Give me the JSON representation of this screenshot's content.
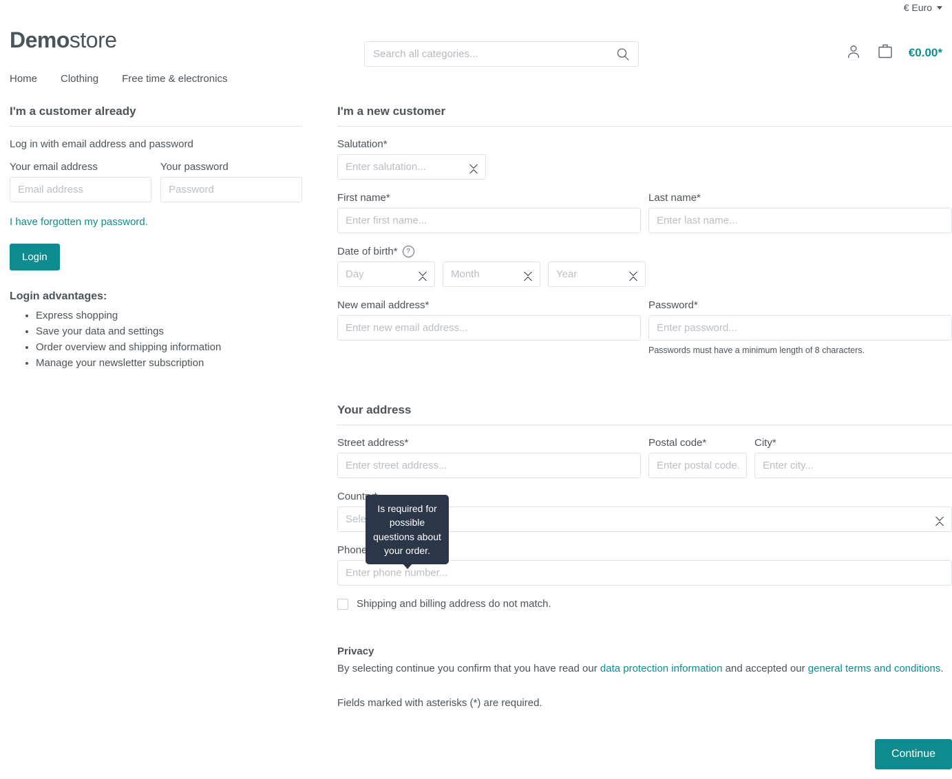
{
  "topbar": {
    "currency": "€ Euro",
    "caret_icon": "chevron-down-icon"
  },
  "header": {
    "logo_bold": "Demo",
    "logo_light": "store",
    "search_placeholder": "Search all categories...",
    "search_value": "",
    "search_icon": "search-icon",
    "account_icon": "user-icon",
    "cart_icon": "shopping-bag-icon",
    "cart_total": "€0.00*"
  },
  "nav": {
    "items": [
      {
        "label": "Home"
      },
      {
        "label": "Clothing"
      },
      {
        "label": "Free time & electronics"
      }
    ]
  },
  "login": {
    "title": "I'm a customer already",
    "subtitle": "Log in with email address and password",
    "email_label": "Your email address",
    "email_placeholder": "Email address",
    "email_value": "",
    "password_label": "Your password",
    "password_placeholder": "Password",
    "password_value": "",
    "forgot_link": "I have forgotten my password.",
    "login_button": "Login",
    "advantages_title": "Login advantages:",
    "advantages": [
      "Express shopping",
      "Save your data and settings",
      "Order overview and shipping information",
      "Manage your newsletter subscription"
    ]
  },
  "register": {
    "title": "I'm a new customer",
    "salutation_label": "Salutation*",
    "salutation_placeholder": "Enter salutation...",
    "firstname_label": "First name*",
    "firstname_placeholder": "Enter first name...",
    "firstname_value": "",
    "lastname_label": "Last name*",
    "lastname_placeholder": "Enter last name...",
    "lastname_value": "",
    "dob_label": "Date of birth*",
    "dob_help_icon": "question-mark-icon",
    "dob_day_placeholder": "Day",
    "dob_month_placeholder": "Month",
    "dob_year_placeholder": "Year",
    "email_label": "New email address*",
    "email_placeholder": "Enter new email address...",
    "email_value": "",
    "password_label": "Password*",
    "password_placeholder": "Enter password...",
    "password_value": "",
    "password_hint": "Passwords must have a minimum length of 8 characters."
  },
  "address": {
    "title": "Your address",
    "street_label": "Street address*",
    "street_placeholder": "Enter street address...",
    "street_value": "",
    "postal_label": "Postal code*",
    "postal_placeholder": "Enter postal code.",
    "postal_value": "",
    "city_label": "City*",
    "city_placeholder": "Enter city...",
    "city_value": "",
    "country_label": "Country*",
    "country_placeholder": "Select country...",
    "phone_label": "Phone number",
    "phone_help_icon": "question-mark-icon",
    "phone_placeholder": "Enter phone number...",
    "phone_value": "",
    "different_shipping_label": "Shipping and billing address do not match.",
    "different_shipping_checked": false
  },
  "tooltip": {
    "text": "Is required for possible questions about your order."
  },
  "privacy": {
    "title": "Privacy",
    "text_before": "By selecting continue you confirm that you have read our ",
    "link1": "data protection information",
    "text_middle": " and accepted our ",
    "link2": "general terms and conditions",
    "text_after": ".",
    "required_note": "Fields marked with asterisks (*) are required."
  },
  "footer_actions": {
    "continue_label": "Continue"
  },
  "colors": {
    "accent": "#0e8b8f",
    "text": "#4a545b",
    "border": "#dfe3e8",
    "tooltip_bg": "#2b3648"
  }
}
